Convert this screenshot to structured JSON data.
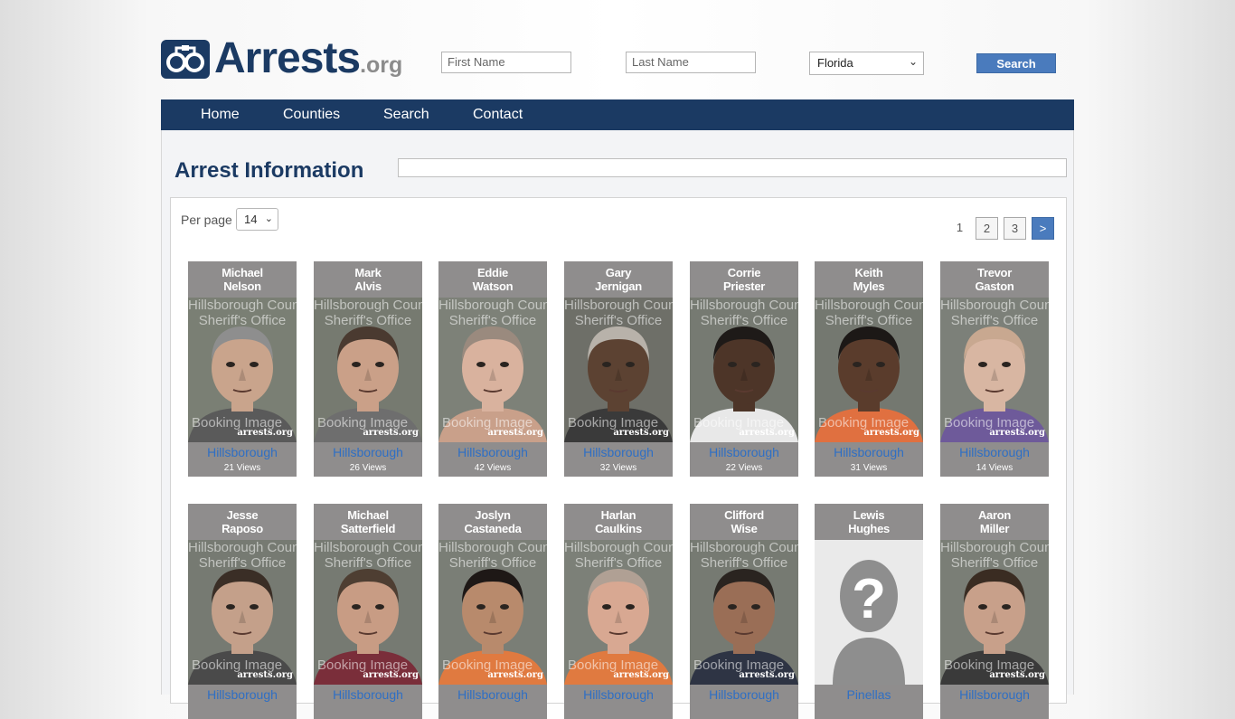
{
  "logo": {
    "icon": "handcuffs-icon",
    "main": "Arrests",
    "tld": ".org"
  },
  "search": {
    "first_name_placeholder": "First Name",
    "last_name_placeholder": "Last Name",
    "state_selected": "Florida",
    "button_label": "Search"
  },
  "nav": {
    "items": [
      "Home",
      "Counties",
      "Search",
      "Contact"
    ]
  },
  "page": {
    "title": "Arrest Information"
  },
  "controls": {
    "per_page_label": "Per page",
    "per_page_value": "14",
    "pagination": [
      "1",
      "2",
      "3",
      ">"
    ]
  },
  "watermark": {
    "top_line1": "Hillsborough County",
    "top_line2": "Sheriff's Office",
    "bottom": "Booking Image",
    "site": "arrests.org"
  },
  "cards": [
    {
      "first": "Michael",
      "last": "Nelson",
      "county": "Hillsborough",
      "views": "21 Views",
      "skin": "#c9a48c",
      "hair": "#8e8e8e",
      "shirt": "#5a5a5a",
      "bg": "#7a7f74"
    },
    {
      "first": "Mark",
      "last": "Alvis",
      "county": "Hillsborough",
      "views": "26 Views",
      "skin": "#caa088",
      "hair": "#4a3a30",
      "shirt": "#6e6e6e",
      "bg": "#767a70"
    },
    {
      "first": "Eddie",
      "last": "Watson",
      "county": "Hillsborough",
      "views": "42 Views",
      "skin": "#d9b29e",
      "hair": "#9a8a7e",
      "shirt": "#c9a08a",
      "bg": "#7d8178"
    },
    {
      "first": "Gary",
      "last": "Jernigan",
      "county": "Hillsborough",
      "views": "32 Views",
      "skin": "#5c4232",
      "hair": "#b8b2aa",
      "shirt": "#3a3a3a",
      "bg": "#6e6f68"
    },
    {
      "first": "Corrie",
      "last": "Priester",
      "county": "Hillsborough",
      "views": "22 Views",
      "skin": "#4d3528",
      "hair": "#1e1a18",
      "shirt": "#e8e8e8",
      "bg": "#767a72"
    },
    {
      "first": "Keith",
      "last": "Myles",
      "county": "Hillsborough",
      "views": "31 Views",
      "skin": "#5a3c2c",
      "hair": "#1c1816",
      "shirt": "#e07040",
      "bg": "#747870"
    },
    {
      "first": "Trevor",
      "last": "Gaston",
      "county": "Hillsborough",
      "views": "14 Views",
      "skin": "#d8b6a2",
      "hair": "#c8a890",
      "shirt": "#6e5a9a",
      "bg": "#7c8079"
    },
    {
      "first": "Jesse",
      "last": "Raposo",
      "county": "Hillsborough",
      "views": "",
      "skin": "#c4a08a",
      "hair": "#3a2e26",
      "shirt": "#4a4a4a",
      "bg": "#767a72"
    },
    {
      "first": "Michael",
      "last": "Satterfield",
      "county": "Hillsborough",
      "views": "",
      "skin": "#c89c84",
      "hair": "#4e3e32",
      "shirt": "#7a2e3a",
      "bg": "#767a72"
    },
    {
      "first": "Joslyn",
      "last": "Castaneda",
      "county": "Hillsborough",
      "views": "",
      "skin": "#b88a6c",
      "hair": "#1e1816",
      "shirt": "#e07a40",
      "bg": "#7a7e76"
    },
    {
      "first": "Harlan",
      "last": "Caulkins",
      "county": "Hillsborough",
      "views": "",
      "skin": "#d8a892",
      "hair": "#b0a094",
      "shirt": "#e07a40",
      "bg": "#7c8078"
    },
    {
      "first": "Clifford",
      "last": "Wise",
      "county": "Hillsborough",
      "views": "",
      "skin": "#9a6e56",
      "hair": "#2a2420",
      "shirt": "#2e3444",
      "bg": "#767a72"
    },
    {
      "first": "Lewis",
      "last": "Hughes",
      "county": "Pinellas",
      "views": "",
      "placeholder": true
    },
    {
      "first": "Aaron",
      "last": "Miller",
      "county": "Hillsborough",
      "views": "",
      "skin": "#c8a08a",
      "hair": "#3a2c22",
      "shirt": "#3a3a3a",
      "bg": "#7a7e76"
    }
  ],
  "colors": {
    "navy": "#1b3a63",
    "accent": "#4a7bbd",
    "link": "#2f6fc4",
    "card_bg": "#8f8d8d"
  }
}
